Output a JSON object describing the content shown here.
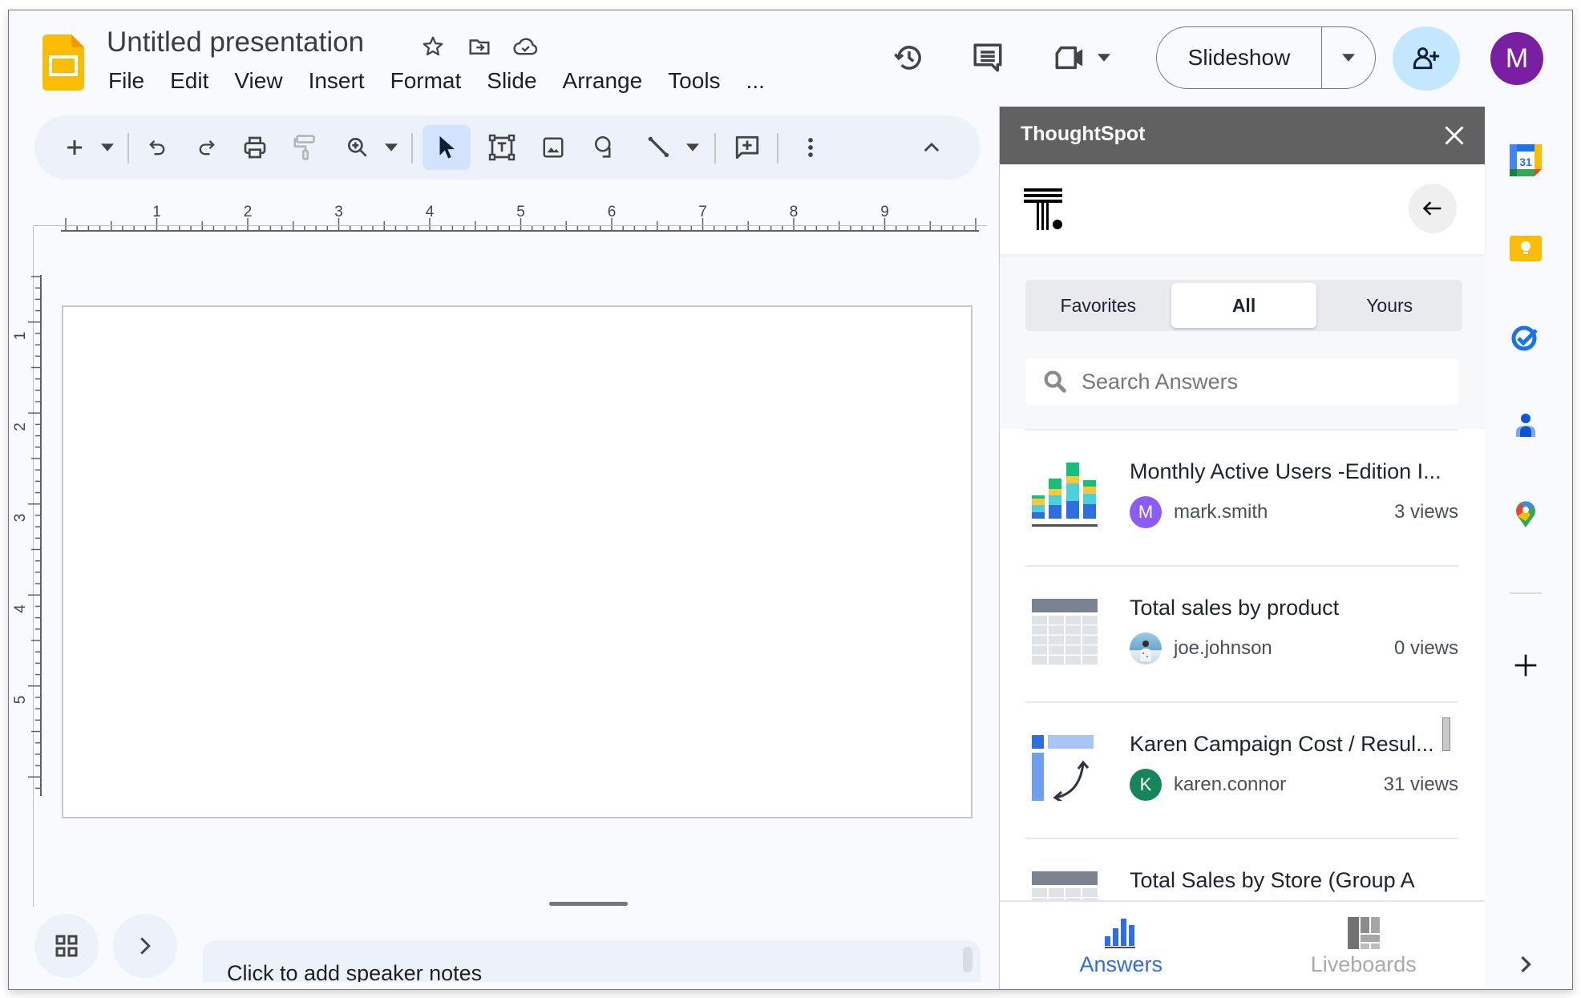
{
  "app": {
    "title": "Untitled presentation",
    "icons": [
      "star-icon",
      "move-to-folder-icon",
      "cloud-saved-icon"
    ],
    "menu": [
      "File",
      "Edit",
      "View",
      "Insert",
      "Format",
      "Slide",
      "Arrange",
      "Tools",
      "..."
    ]
  },
  "header": {
    "slideshow_label": "Slideshow",
    "account_initial": "M",
    "account_color": "#7b1fa2",
    "share_color": "#c2e7ff"
  },
  "toolbar": {
    "items": [
      "new-slide",
      "new-slide-dropdown",
      "undo",
      "redo",
      "print",
      "paint-format",
      "zoom",
      "zoom-dropdown",
      "select",
      "text-box",
      "insert-image",
      "shape",
      "line",
      "line-dropdown",
      "add-comment",
      "more-options",
      "collapse-toolbar"
    ],
    "active": "select"
  },
  "rulers": {
    "horizontal_labels": [
      "1",
      "2",
      "3",
      "4",
      "5",
      "6",
      "7",
      "8",
      "9"
    ],
    "vertical_labels": [
      "1",
      "2",
      "3",
      "4",
      "5"
    ]
  },
  "notes": {
    "placeholder": "Click to add speaker notes"
  },
  "panel": {
    "title": "ThoughtSpot",
    "tabs": [
      {
        "label": "Favorites",
        "active": false
      },
      {
        "label": "All",
        "active": true
      },
      {
        "label": "Yours",
        "active": false
      }
    ],
    "search_placeholder": "Search Answers",
    "items": [
      {
        "title": "Monthly Active Users -Edition I...",
        "owner": "mark.smith",
        "owner_initial": "M",
        "avatar_color": "#8b5cf6",
        "views": "3 views",
        "thumb": "stacked-bar-chart"
      },
      {
        "title": "Total sales by product",
        "owner": "joe.johnson",
        "owner_initial": "",
        "avatar_color": "#7fb3d5",
        "views": "0 views",
        "thumb": "table"
      },
      {
        "title": "Karen Campaign Cost / Resul...",
        "owner": "karen.connor",
        "owner_initial": "K",
        "avatar_color": "#15855a",
        "views": "31 views",
        "thumb": "pivot-table"
      },
      {
        "title": "Total Sales by Store (Group A",
        "owner": "",
        "owner_initial": "",
        "avatar_color": "",
        "views": "",
        "thumb": "table"
      }
    ],
    "nav": [
      {
        "label": "Answers",
        "active": true,
        "color": "#2f6de1"
      },
      {
        "label": "Liveboards",
        "active": false,
        "color": "#a9a9a9"
      }
    ]
  },
  "rail": {
    "apps": [
      "Calendar",
      "Keep",
      "Tasks",
      "Contacts",
      "Maps"
    ],
    "calendar_day": "31"
  }
}
